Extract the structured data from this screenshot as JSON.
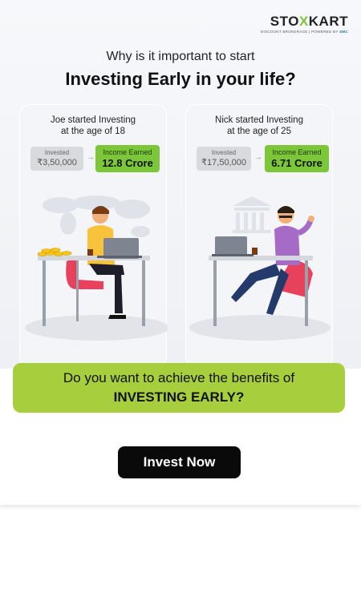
{
  "brand": {
    "name_pre": "STO",
    "name_x": "X",
    "name_post": "KART",
    "tagline_pre": "DISCOUNT BROKERAGE | POWERED BY ",
    "tagline_brand": "SMC"
  },
  "headline": {
    "line1": "Why is it important to start",
    "line2": "Investing Early in your life?"
  },
  "cards": [
    {
      "title_line1": "Joe started Investing",
      "title_line2": "at the age of 18",
      "invested_label": "Invested",
      "invested_value": "₹3,50,000",
      "earned_label": "Income Earned",
      "earned_value": "12.8 Crore"
    },
    {
      "title_line1": "Nick started Investing",
      "title_line2": "at the age of 25",
      "invested_label": "Invested",
      "invested_value": "₹17,50,000",
      "earned_label": "Income Earned",
      "earned_value": "6.71 Crore"
    }
  ],
  "banner": {
    "line1": "Do you want to achieve the benefits of",
    "line2": "INVESTING EARLY?"
  },
  "cta": {
    "label": "Invest Now"
  },
  "colors": {
    "accent_green": "#7cc63a",
    "banner_green": "#a7ce3c",
    "cta_bg": "#0a0a0a"
  }
}
